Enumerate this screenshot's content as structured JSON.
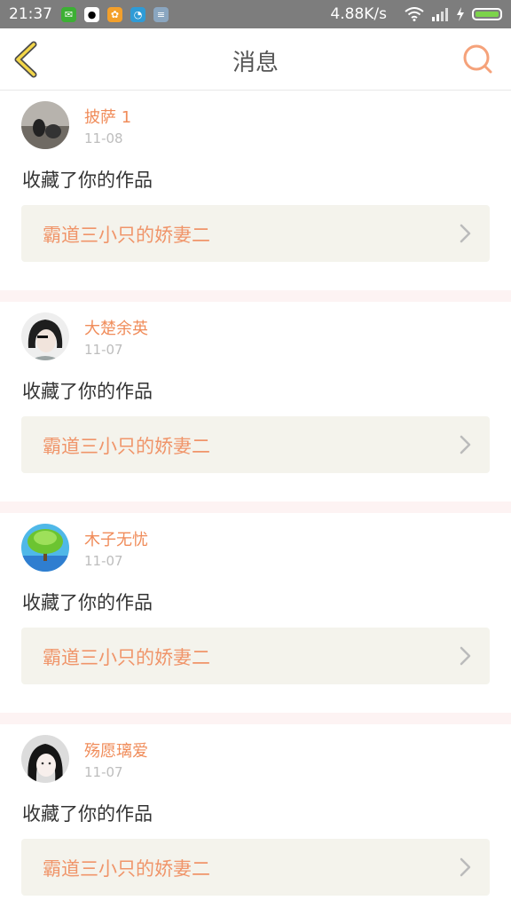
{
  "status_bar": {
    "time": "21:37",
    "net_speed": "4.88K/s",
    "apps": [
      {
        "icon": "wechat-icon",
        "color": "#3cb034"
      },
      {
        "icon": "qq-icon",
        "color": "#ffffff"
      },
      {
        "icon": "app-orange-icon",
        "color": "#f3a02b"
      },
      {
        "icon": "app-blue-icon",
        "color": "#2f9bd6"
      },
      {
        "icon": "app-grey-icon",
        "color": "#8aa6c0"
      }
    ]
  },
  "header": {
    "title": "消息",
    "back_icon": "chevron-left-icon",
    "search_icon": "search-icon",
    "accent": "#f5a27a"
  },
  "messages": [
    {
      "name": "披萨 1",
      "date": "11-08",
      "action": "收藏了你的作品",
      "work": "霸道三小只的娇妻二"
    },
    {
      "name": "大楚余英",
      "date": "11-07",
      "action": "收藏了你的作品",
      "work": "霸道三小只的娇妻二"
    },
    {
      "name": "木子无忧",
      "date": "11-07",
      "action": "收藏了你的作品",
      "work": "霸道三小只的娇妻二"
    },
    {
      "name": "殇愿璃爱",
      "date": "11-07",
      "action": "收藏了你的作品",
      "work": "霸道三小只的娇妻二"
    }
  ]
}
